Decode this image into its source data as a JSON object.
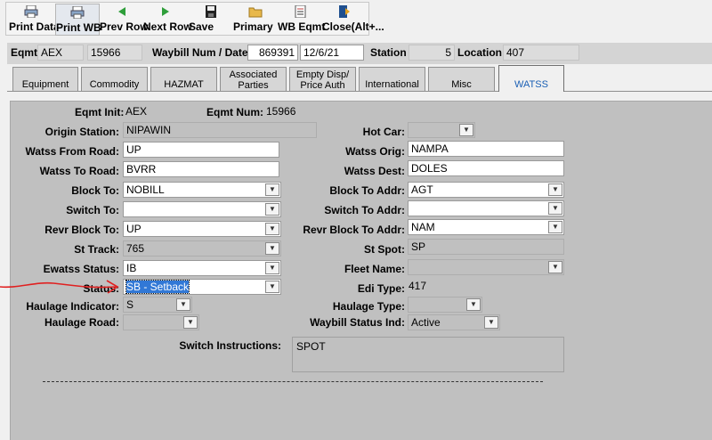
{
  "toolbar": {
    "buttons": [
      {
        "label": "Print Data",
        "icon": "printer-icon"
      },
      {
        "label": "Print WB",
        "icon": "printer-icon"
      },
      {
        "label": "Prev Row",
        "icon": "arrow-left-icon"
      },
      {
        "label": "Next Row",
        "icon": "arrow-right-icon"
      },
      {
        "label": "Save",
        "icon": "floppy-icon"
      },
      {
        "label": "Primary",
        "icon": "folder-icon"
      },
      {
        "label": "WB Eqmt",
        "icon": "list-icon"
      },
      {
        "label": "Close(Alt+...",
        "icon": "exit-door-icon"
      }
    ]
  },
  "header": {
    "eqmt_label": "Eqmt",
    "eqmt_init": "AEX",
    "eqmt_num": "15966",
    "waybill_label": "Waybill Num / Date",
    "waybill_num": "869391",
    "waybill_date": "12/6/21",
    "station_label": "Station",
    "station_value": "5",
    "location_label": "Location",
    "location_value": "407"
  },
  "tabs": [
    {
      "label": "Equipment"
    },
    {
      "label": "Commodity"
    },
    {
      "label": "HAZMAT"
    },
    {
      "label": "Associated Parties"
    },
    {
      "label": "Empty Disp/ Price Auth"
    },
    {
      "label": "International"
    },
    {
      "label": "Misc"
    },
    {
      "label": "WATSS",
      "active": true
    }
  ],
  "form": {
    "eqmt_init": {
      "label": "Eqmt Init:",
      "value": "AEX"
    },
    "eqmt_num": {
      "label": "Eqmt Num:",
      "value": "15966"
    },
    "origin_station": {
      "label": "Origin Station:",
      "value": "NIPAWIN"
    },
    "hot_car": {
      "label": "Hot Car:",
      "value": ""
    },
    "watss_from_road": {
      "label": "Watss From Road:",
      "value": "UP"
    },
    "watss_orig": {
      "label": "Watss Orig:",
      "value": "NAMPA"
    },
    "watss_to_road": {
      "label": "Watss To Road:",
      "value": "BVRR"
    },
    "watss_dest": {
      "label": "Watss Dest:",
      "value": "DOLES"
    },
    "block_to": {
      "label": "Block To:",
      "value": "NOBILL"
    },
    "block_to_addr": {
      "label": "Block To Addr:",
      "value": "AGT"
    },
    "switch_to": {
      "label": "Switch To:",
      "value": ""
    },
    "switch_to_addr": {
      "label": "Switch To Addr:",
      "value": ""
    },
    "revr_block_to": {
      "label": "Revr Block To:",
      "value": "UP"
    },
    "revr_block_to_addr": {
      "label": "Revr Block To Addr:",
      "value": "NAM"
    },
    "st_track": {
      "label": "St Track:",
      "value": "765"
    },
    "st_spot": {
      "label": "St Spot:",
      "value": "SP"
    },
    "ewatss_status": {
      "label": "Ewatss Status:",
      "value": "IB"
    },
    "fleet_name": {
      "label": "Fleet Name:",
      "value": ""
    },
    "status": {
      "label": "Status:",
      "value": "SB - Setback"
    },
    "edi_type": {
      "label": "Edi Type:",
      "value": "417"
    },
    "haulage_indicator": {
      "label": "Haulage Indicator:",
      "value": "S"
    },
    "haulage_type": {
      "label": "Haulage Type:",
      "value": ""
    },
    "haulage_road": {
      "label": "Haulage Road:",
      "value": ""
    },
    "waybill_status_ind": {
      "label": "Waybill Status Ind:",
      "value": "Active"
    },
    "switch_instructions": {
      "label": "Switch Instructions:",
      "value": "SPOT"
    }
  },
  "colors": {
    "active_tab_text": "#1a5fb4",
    "selection_highlight": "#3178d6",
    "annotation_arrow": "#e02020"
  }
}
